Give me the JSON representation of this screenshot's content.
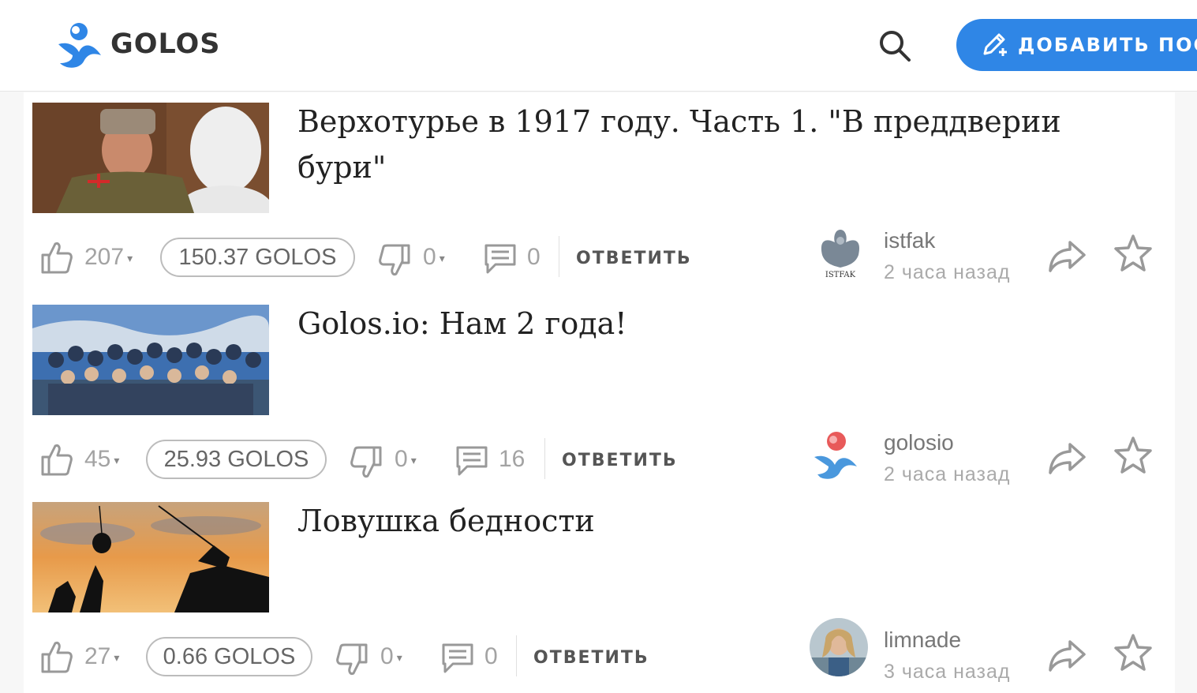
{
  "header": {
    "brand": "GOLOS",
    "add_post_label": "ДОБАВИТЬ ПОСТ"
  },
  "colors": {
    "accent": "#2f86e6",
    "text": "#222222",
    "muted": "#a3a3a3"
  },
  "posts": [
    {
      "title": "Верхотурье в 1917 году. Часть 1. \"В преддверии бури\"",
      "likes": "207",
      "payout": "150.37 GOLOS",
      "dislikes": "0",
      "comments": "0",
      "reply_label": "ОТВЕТИТЬ",
      "author": "istfak",
      "time": "2 часа назад",
      "avatar_text": "ISTFAK"
    },
    {
      "title": "Golos.io: Нам 2 года!",
      "likes": "45",
      "payout": "25.93 GOLOS",
      "dislikes": "0",
      "comments": "16",
      "reply_label": "ОТВЕТИТЬ",
      "author": "golosio",
      "time": "2 часа назад"
    },
    {
      "title": "Ловушка бедности",
      "likes": "27",
      "payout": "0.66 GOLOS",
      "dislikes": "0",
      "comments": "0",
      "reply_label": "ОТВЕТИТЬ",
      "author": "limnade",
      "time": "3 часа назад"
    }
  ]
}
